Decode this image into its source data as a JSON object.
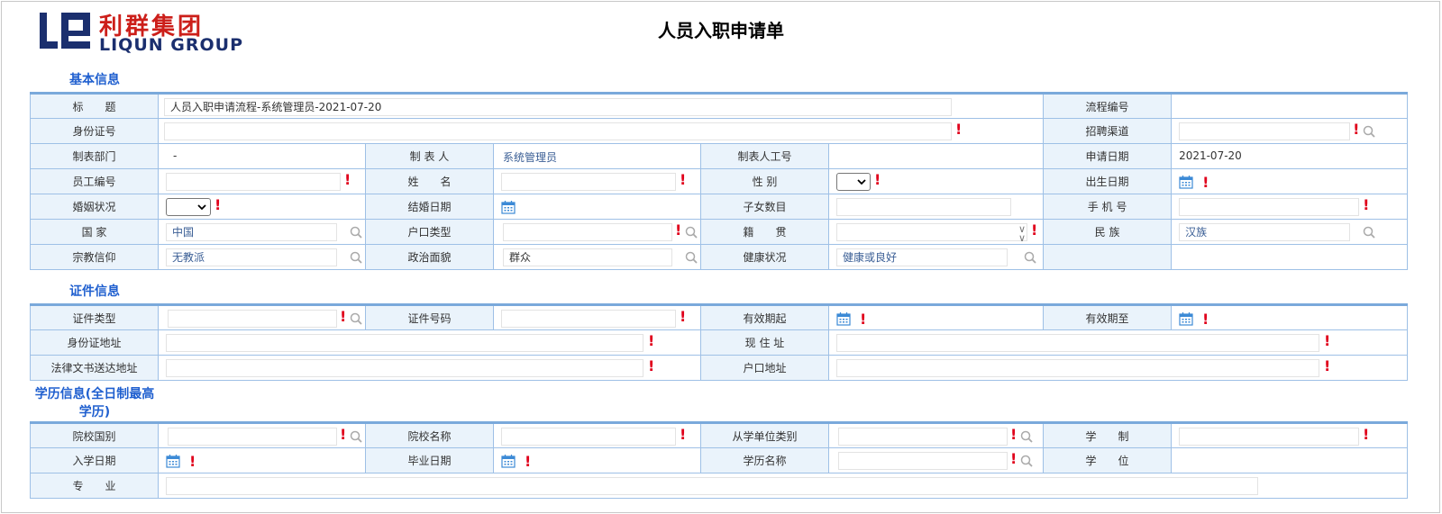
{
  "header": {
    "logo_cn": "利群集团",
    "logo_en": "LIQUN GROUP",
    "title": "人员入职申请单"
  },
  "sections": {
    "basic": "基本信息",
    "cert": "证件信息",
    "edu": "学历信息(全日制最高学历)"
  },
  "basic": {
    "title_label": "标　　题",
    "title_value": "人员入职申请流程-系统管理员-2021-07-20",
    "flow_no_label": "流程编号",
    "id_label": "身份证号",
    "channel_label": "招聘渠道",
    "dept_label": "制表部门",
    "dept_value": "-",
    "maker_label": "制 表 人",
    "maker_value": "系统管理员",
    "maker_id_label": "制表人工号",
    "apply_date_label": "申请日期",
    "apply_date_value": "2021-07-20",
    "emp_no_label": "员工编号",
    "name_label": "姓　　名",
    "gender_label": "性 别",
    "birth_label": "出生日期",
    "marital_label": "婚姻状况",
    "marry_date_label": "结婚日期",
    "children_label": "子女数目",
    "phone_label": "手 机 号",
    "country_label": "国 家",
    "country_value": "中国",
    "hukou_type_label": "户口类型",
    "native_label": "籍　　贯",
    "ethnic_label": "民 族",
    "ethnic_value": "汉族",
    "religion_label": "宗教信仰",
    "religion_value": "无教派",
    "political_label": "政治面貌",
    "political_value": "群众",
    "health_label": "健康状况",
    "health_value": "健康或良好"
  },
  "cert": {
    "type_label": "证件类型",
    "no_label": "证件号码",
    "valid_from_label": "有效期起",
    "valid_to_label": "有效期至",
    "id_addr_label": "身份证地址",
    "cur_addr_label": "现 住 址",
    "legal_addr_label": "法律文书送达地址",
    "hukou_addr_label": "户口地址"
  },
  "edu": {
    "school_country_label": "院校国别",
    "school_name_label": "院校名称",
    "unit_type_label": "从学单位类别",
    "system_label": "学　　制",
    "enroll_label": "入学日期",
    "grad_label": "毕业日期",
    "degree_name_label": "学历名称",
    "degree_label": "学　　位",
    "major_label": "专　　业"
  },
  "colors": {
    "accent": "#1f5fcf",
    "label_bg": "#eaf3fb",
    "border": "#9ec0e6",
    "required": "#e0001b",
    "logo_red": "#cc1f1a",
    "logo_blue": "#1b2f6e"
  },
  "icons": {
    "search": "search-icon",
    "calendar": "calendar-icon",
    "required": "required-mark",
    "dropdown": "chevron-down-icon"
  }
}
